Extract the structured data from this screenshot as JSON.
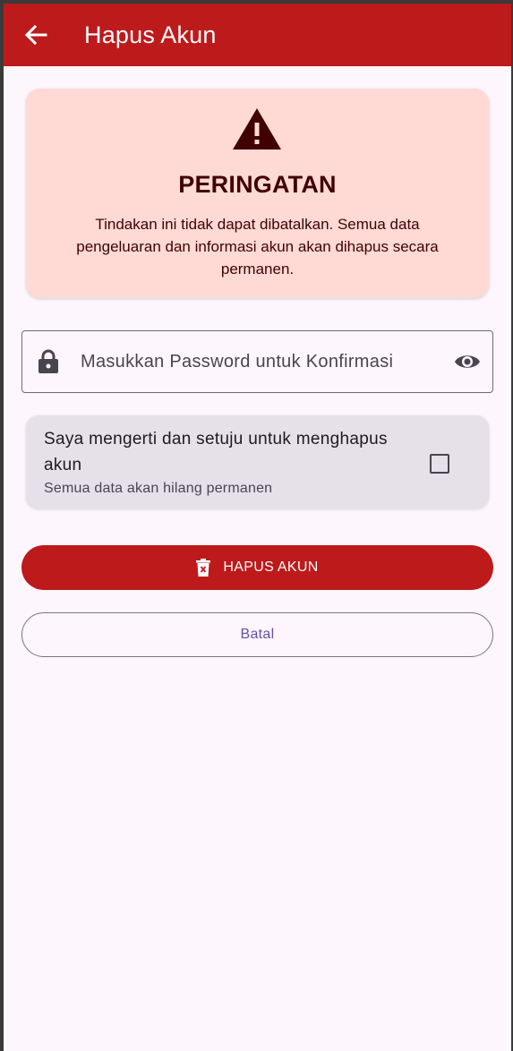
{
  "appbar": {
    "title": "Hapus Akun"
  },
  "warning": {
    "title": "PERINGATAN",
    "text": "Tindakan ini tidak dapat dibatalkan. Semua data pengeluaran dan informasi akun akan dihapus secara permanen."
  },
  "password": {
    "placeholder": "Masukkan Password untuk Konfirmasi",
    "value": ""
  },
  "confirm": {
    "title": "Saya mengerti dan setuju untuk menghapus akun",
    "subtitle": "Semua data akan hilang permanen",
    "checked": false
  },
  "actions": {
    "delete_label": "HAPUS AKUN",
    "cancel_label": "Batal"
  },
  "colors": {
    "primary_red": "#bd1a1c",
    "warning_bg": "#ffdad5",
    "warning_text": "#410002",
    "card_bg": "#e6e0e9",
    "page_bg": "#fdf6fc",
    "accent_purple": "#6750a4"
  },
  "icons": {
    "back": "arrow-left-icon",
    "warning": "warning-triangle-icon",
    "lock": "lock-icon",
    "visibility": "eye-icon",
    "delete": "trash-icon",
    "checkbox": "checkbox-outline-icon"
  }
}
